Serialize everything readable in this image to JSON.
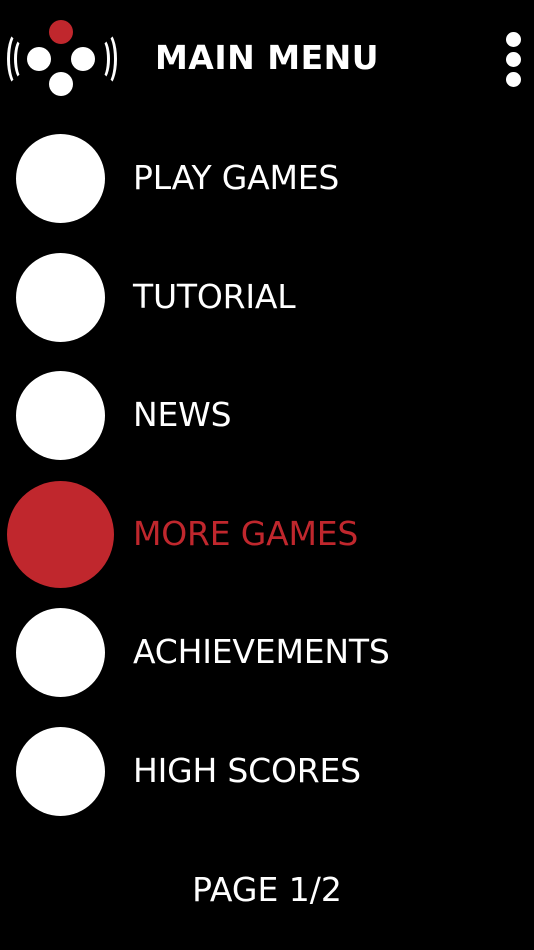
{
  "header": {
    "title": "MAIN MENU",
    "logo_icon": "gamepad-signal-icon",
    "menu_icon": "kebab-menu-icon"
  },
  "menu": {
    "items": [
      {
        "label": "PLAY GAMES",
        "active": false
      },
      {
        "label": "TUTORIAL",
        "active": false
      },
      {
        "label": "NEWS",
        "active": false
      },
      {
        "label": "MORE GAMES",
        "active": true
      },
      {
        "label": "ACHIEVEMENTS",
        "active": false
      },
      {
        "label": "HIGH SCORES",
        "active": false
      }
    ]
  },
  "footer": {
    "page_indicator": "PAGE 1/2"
  },
  "colors": {
    "background": "#000000",
    "foreground": "#ffffff",
    "accent": "#c0272d"
  }
}
